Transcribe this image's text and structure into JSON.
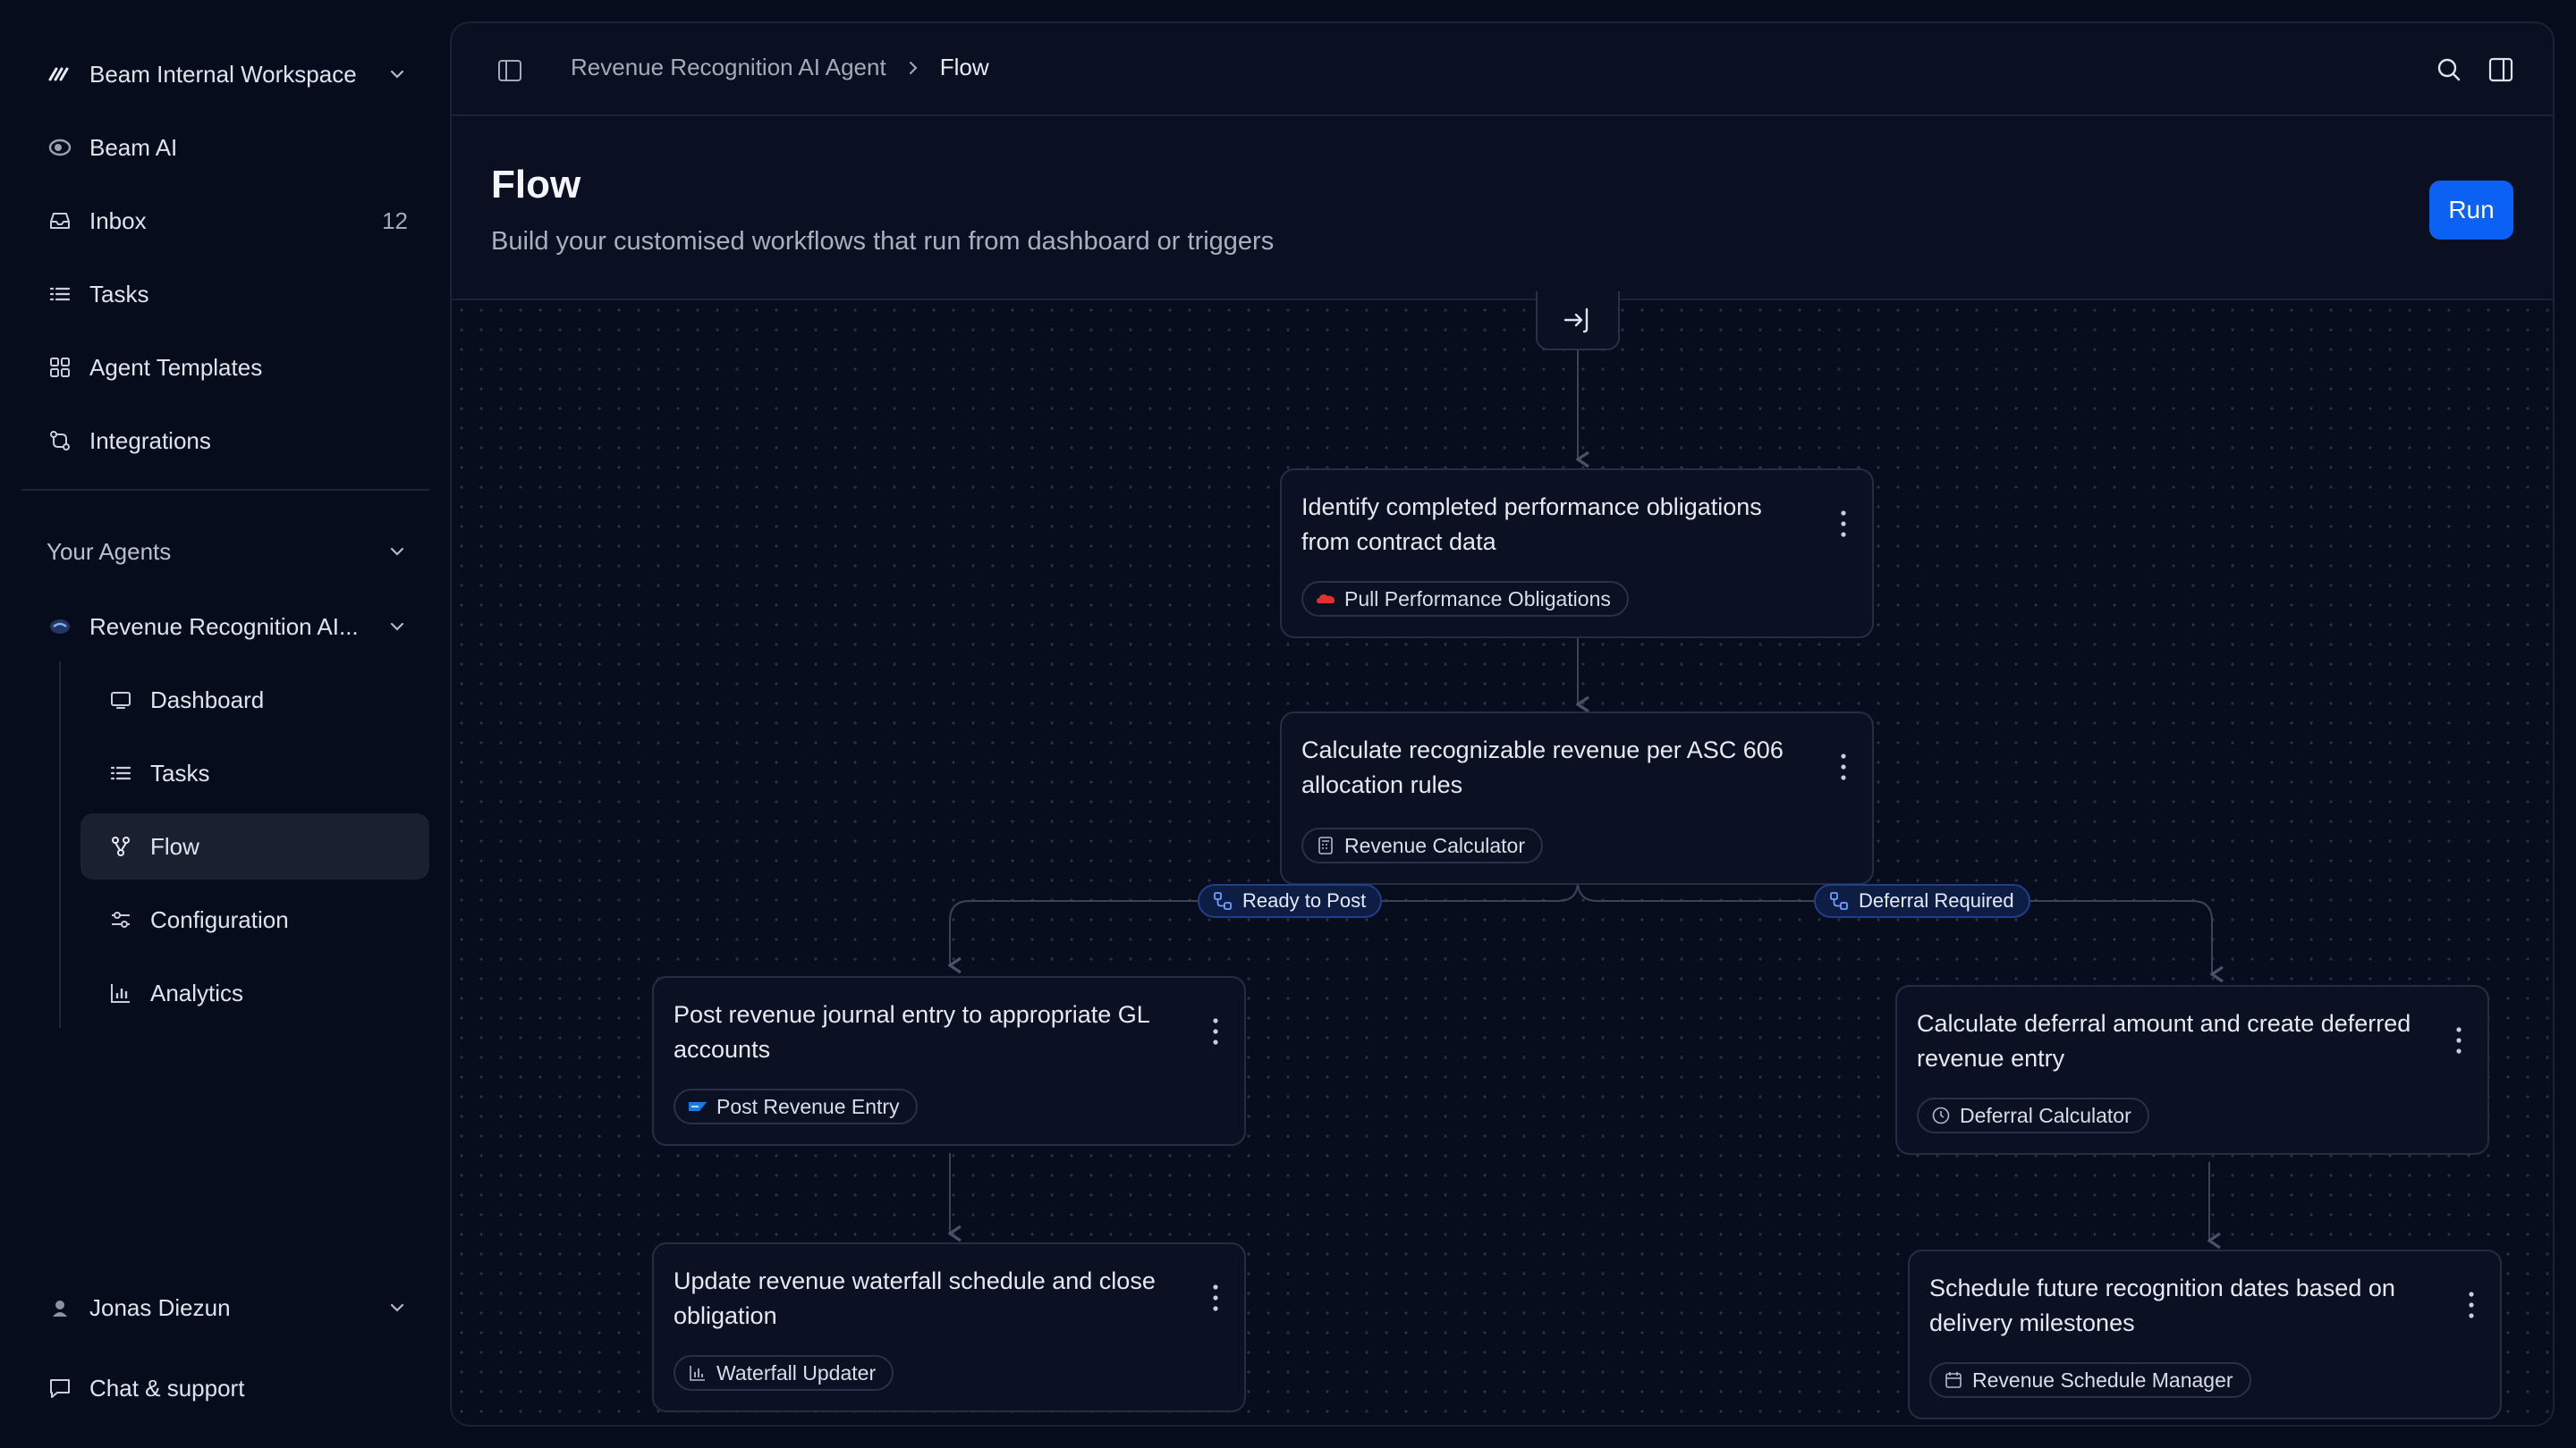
{
  "sidebar": {
    "workspace": "Beam Internal Workspace",
    "nav": [
      {
        "label": "Beam AI",
        "icon": "beam-logo-icon"
      },
      {
        "label": "Inbox",
        "icon": "inbox-icon",
        "count": "12"
      },
      {
        "label": "Tasks",
        "icon": "list-icon"
      },
      {
        "label": "Agent Templates",
        "icon": "grid-icon"
      },
      {
        "label": "Integrations",
        "icon": "integrations-icon"
      }
    ],
    "agents_section": "Your Agents",
    "current_agent": "Revenue Recognition AI...",
    "agent_sub": [
      {
        "label": "Dashboard",
        "icon": "monitor-icon"
      },
      {
        "label": "Tasks",
        "icon": "list-icon"
      },
      {
        "label": "Flow",
        "icon": "flow-icon",
        "active": true
      },
      {
        "label": "Configuration",
        "icon": "sliders-icon"
      },
      {
        "label": "Analytics",
        "icon": "chart-icon"
      }
    ],
    "user": "Jonas Diezun",
    "support": "Chat & support"
  },
  "topbar": {
    "breadcrumb": [
      "Revenue Recognition AI Agent",
      "Flow"
    ]
  },
  "header": {
    "title": "Flow",
    "subtitle": "Build your customised workflows that run from dashboard or triggers",
    "run_label": "Run"
  },
  "colors": {
    "accent": "#0b61f4",
    "background": "#070c1c",
    "branch_badge": "#0d1d44"
  },
  "flow": {
    "nodes": [
      {
        "text": "Identify completed performance obligations from contract data",
        "tool": "Pull Performance Obligations",
        "tool_icon": "salesforce-cloud-icon"
      },
      {
        "text": "Calculate recognizable revenue per ASC 606 allocation rules",
        "tool": "Revenue Calculator",
        "tool_icon": "calculator-icon"
      },
      {
        "text": "Post revenue journal entry to appropriate GL accounts",
        "tool": "Post Revenue Entry",
        "tool_icon": "sap-icon"
      },
      {
        "text": "Calculate deferral amount and create deferred revenue entry",
        "tool": "Deferral Calculator",
        "tool_icon": "clock-icon"
      },
      {
        "text": "Update revenue waterfall schedule and close obligation",
        "tool": "Waterfall Updater",
        "tool_icon": "bar-chart-icon"
      },
      {
        "text": "Schedule future recognition dates based on delivery milestones",
        "tool": "Revenue Schedule Manager",
        "tool_icon": "calendar-icon"
      }
    ],
    "branches": [
      {
        "label": "Ready to Post"
      },
      {
        "label": "Deferral Required"
      }
    ]
  }
}
